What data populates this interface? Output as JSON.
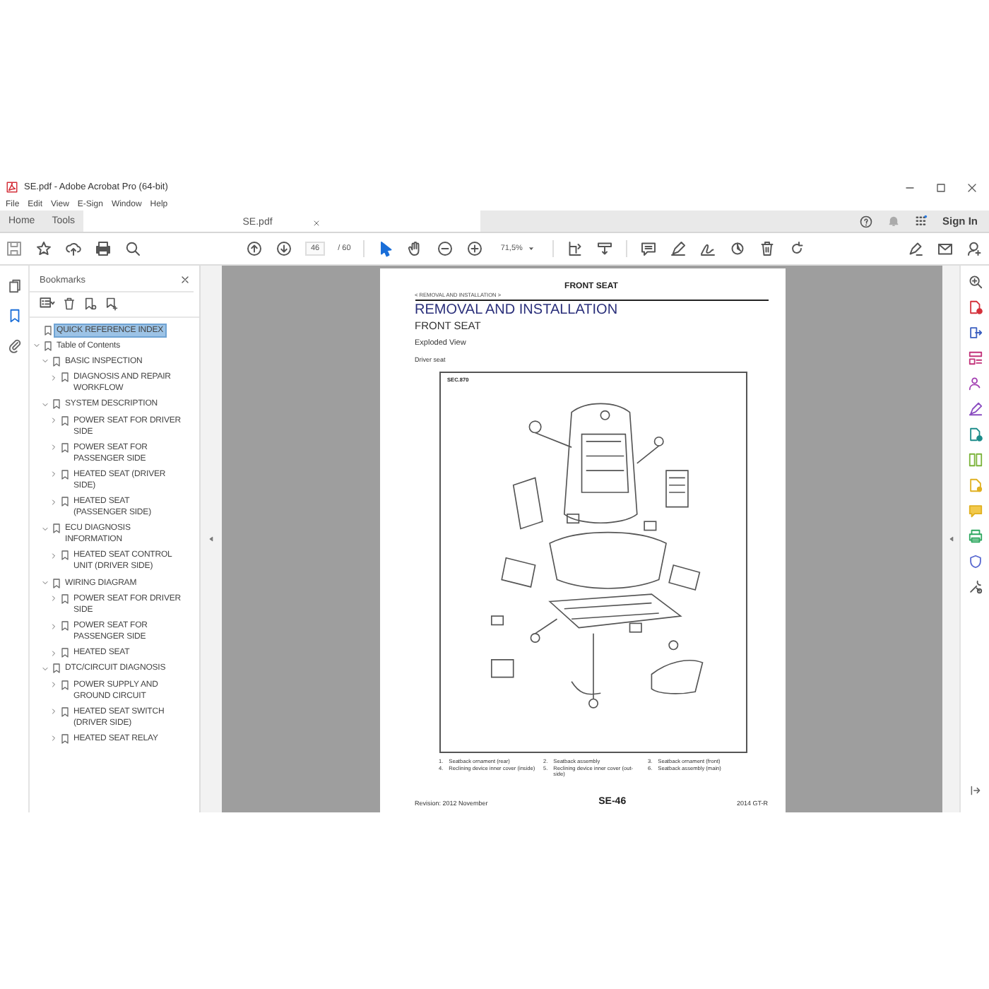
{
  "window": {
    "title": "SE.pdf - Adobe Acrobat Pro (64-bit)"
  },
  "menu": [
    "File",
    "Edit",
    "View",
    "E-Sign",
    "Window",
    "Help"
  ],
  "tabs": [
    {
      "label": "Home",
      "kind": "nav",
      "selected": false
    },
    {
      "label": "Tools",
      "kind": "nav",
      "selected": false
    },
    {
      "label": "SE.pdf",
      "kind": "document",
      "selected": true
    }
  ],
  "account": {
    "sign_in": "Sign In"
  },
  "toolbar": {
    "page": "46",
    "page_total": "/ 60",
    "zoom": "71,5%"
  },
  "left_rail": [
    {
      "kind": "pages",
      "selected": false
    },
    {
      "kind": "bookmarks",
      "selected": true
    },
    {
      "kind": "attachments",
      "selected": false
    }
  ],
  "bookmarks": {
    "title": "Bookmarks",
    "items": [
      {
        "label": "QUICK REFERENCE INDEX",
        "selected": true,
        "expandable": false,
        "expanded": false
      },
      {
        "label": "Table of Contents",
        "selected": false,
        "expandable": true,
        "expanded": true,
        "children": [
          {
            "label": "BASIC INSPECTION",
            "selected": false,
            "expandable": true,
            "expanded": true,
            "children": [
              {
                "label": "DIAGNOSIS AND REPAIR WORKFLOW",
                "selected": false,
                "expandable": true,
                "expanded": false
              }
            ]
          },
          {
            "label": "SYSTEM DESCRIPTION",
            "selected": false,
            "expandable": true,
            "expanded": true,
            "children": [
              {
                "label": "POWER SEAT FOR DRIVER SIDE",
                "selected": false,
                "expandable": true,
                "expanded": false
              },
              {
                "label": "POWER SEAT FOR PASSENGER SIDE",
                "selected": false,
                "expandable": true,
                "expanded": false
              },
              {
                "label": "HEATED SEAT (DRIVER SIDE)",
                "selected": false,
                "expandable": true,
                "expanded": false
              },
              {
                "label": "HEATED SEAT (PASSENGER SIDE)",
                "selected": false,
                "expandable": true,
                "expanded": false
              }
            ]
          },
          {
            "label": "ECU DIAGNOSIS INFORMATION",
            "selected": false,
            "expandable": true,
            "expanded": true,
            "children": [
              {
                "label": "HEATED SEAT CONTROL UNIT (DRIVER SIDE)",
                "selected": false,
                "expandable": true,
                "expanded": false
              }
            ]
          },
          {
            "label": "WIRING DIAGRAM",
            "selected": false,
            "expandable": true,
            "expanded": true,
            "children": [
              {
                "label": "POWER SEAT FOR DRIVER SIDE",
                "selected": false,
                "expandable": true,
                "expanded": false
              },
              {
                "label": "POWER SEAT FOR PASSENGER SIDE",
                "selected": false,
                "expandable": true,
                "expanded": false
              },
              {
                "label": "HEATED SEAT",
                "selected": false,
                "expandable": true,
                "expanded": false
              }
            ]
          },
          {
            "label": "DTC/CIRCUIT DIAGNOSIS",
            "selected": false,
            "expandable": true,
            "expanded": true,
            "children": [
              {
                "label": "POWER SUPPLY AND GROUND CIRCUIT",
                "selected": false,
                "expandable": true,
                "expanded": false
              },
              {
                "label": "HEATED SEAT SWITCH (DRIVER SIDE)",
                "selected": false,
                "expandable": true,
                "expanded": false
              },
              {
                "label": "HEATED SEAT RELAY",
                "selected": false,
                "expandable": true,
                "expanded": false
              }
            ]
          }
        ]
      }
    ]
  },
  "document_page": {
    "running_header": "FRONT SEAT",
    "breadcrumb": "< REMOVAL AND INSTALLATION >",
    "title": "REMOVAL AND INSTALLATION",
    "subtitle": "FRONT SEAT",
    "section": "Exploded View",
    "caption": "Driver seat",
    "figure_label": "SEC.870",
    "legend": [
      {
        "number": "1.",
        "text": "Seatback ornament (rear)"
      },
      {
        "number": "2.",
        "text": "Seatback assembly"
      },
      {
        "number": "3.",
        "text": "Seatback ornament (front)"
      },
      {
        "number": "4.",
        "text": "Reclining device inner cover (inside)"
      },
      {
        "number": "5.",
        "text": "Reclining device inner cover (out-side)"
      },
      {
        "number": "6.",
        "text": "Seatback assembly (main)"
      }
    ],
    "footer": {
      "revision": "Revision: 2012 November",
      "page_number": "SE-46",
      "model": "2014 GT-R"
    }
  }
}
